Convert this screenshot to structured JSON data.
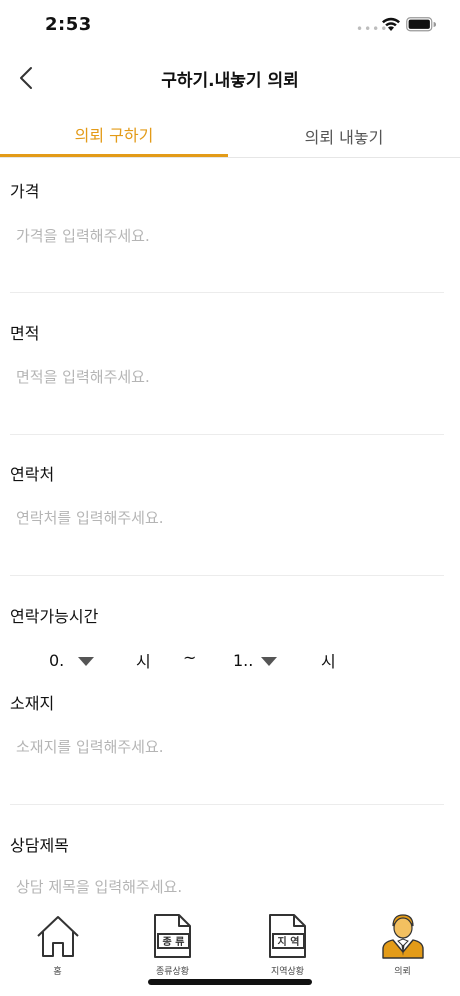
{
  "status": {
    "time": "2:53",
    "signal_dots": "••••"
  },
  "header": {
    "back_icon": "chevron-left-icon",
    "title": "구하기.내놓기 의뢰"
  },
  "tabs": [
    {
      "label": "의뢰 구하기",
      "active": true
    },
    {
      "label": "의뢰 내놓기",
      "active": false
    }
  ],
  "form": {
    "price": {
      "label": "가격",
      "placeholder": "가격을 입력해주세요.",
      "value": ""
    },
    "area": {
      "label": "면적",
      "placeholder": "면적을 입력해주세요.",
      "value": ""
    },
    "contact": {
      "label": "연락처",
      "placeholder": "연락처를 입력해주세요.",
      "value": ""
    },
    "contact_time": {
      "label": "연락가능시간",
      "start": "0.",
      "start_unit": "시",
      "separator": "~",
      "end": "1..",
      "end_unit": "시"
    },
    "location": {
      "label": "소재지",
      "placeholder": "소재지를 입력해주세요.",
      "value": ""
    },
    "consult_title": {
      "label": "상담제목",
      "placeholder": "상담 제목을 입력해주세요.",
      "value": ""
    }
  },
  "tabbar": {
    "items": [
      {
        "label": "홈",
        "icon": "home-icon",
        "active": false
      },
      {
        "label": "종류상황",
        "icon": "document-type-icon",
        "badge": "종 류",
        "active": false
      },
      {
        "label": "지역상황",
        "icon": "document-region-icon",
        "badge": "지 역",
        "active": false
      },
      {
        "label": "의뢰",
        "icon": "person-suit-icon",
        "active": true
      }
    ]
  },
  "colors": {
    "accent": "#e39b18",
    "text": "#111111",
    "placeholder": "#b5b5b5",
    "divider": "#ececec"
  }
}
